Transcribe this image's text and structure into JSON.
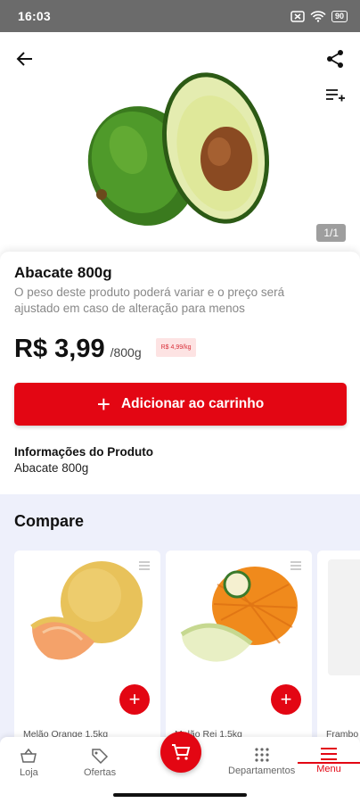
{
  "status_bar": {
    "time": "16:03",
    "battery": "90"
  },
  "hero": {
    "image_counter": "1/1"
  },
  "product": {
    "title": "Abacate 800g",
    "note": "O peso deste produto poderá variar e o preço será ajustado em caso de alteração para menos",
    "price": "R$ 3,99",
    "unit": "/800g",
    "price_per_kg": "R$ 4,99/kg",
    "add_to_cart_label": "Adicionar ao carrinho",
    "info_heading": "Informações do Produto",
    "info_value": "Abacate 800g"
  },
  "compare": {
    "title": "Compare",
    "cards": [
      {
        "name": "Melão Orange 1,5kg"
      },
      {
        "name": "Melão Rei 1,5kg"
      },
      {
        "name": "Frambo"
      }
    ]
  },
  "bottom_nav": {
    "items": [
      {
        "label": "Loja",
        "icon": "basket-icon"
      },
      {
        "label": "Ofertas",
        "icon": "tag-icon"
      },
      {
        "label": "Departamentos",
        "icon": "grid-icon"
      },
      {
        "label": "Menu",
        "icon": "hamburger-icon"
      }
    ]
  },
  "colors": {
    "accent": "#e30613",
    "status_bar": "#6b6b6b",
    "compare_bg": "#eef0fb"
  }
}
